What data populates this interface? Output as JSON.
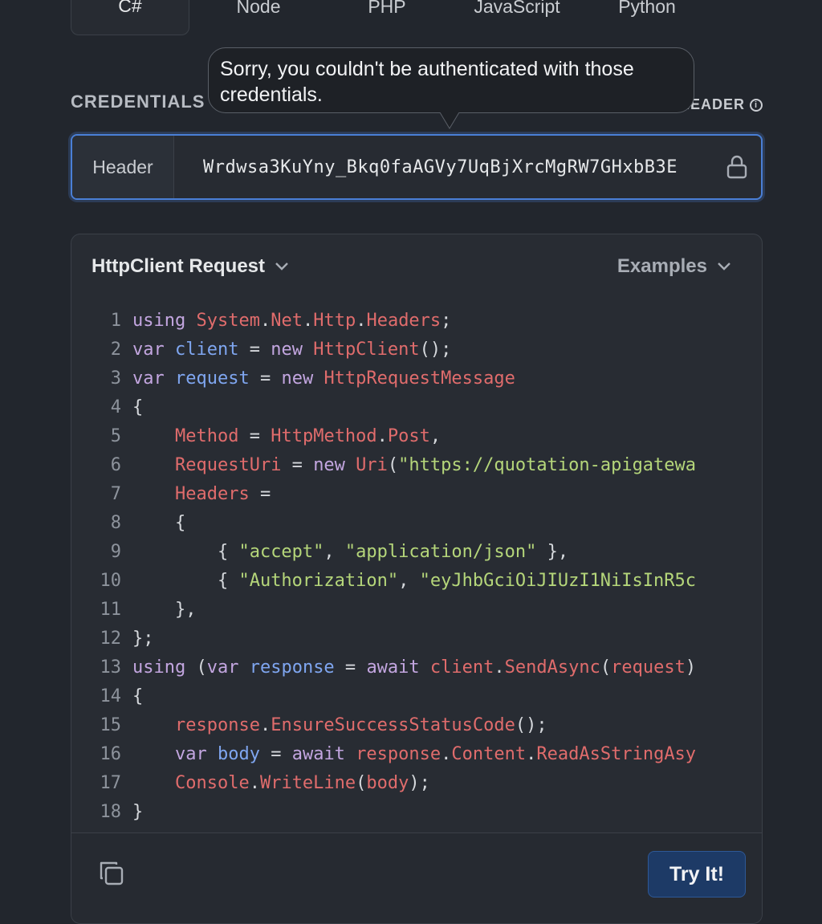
{
  "lang_tabs": [
    {
      "label": "C#",
      "active": true
    },
    {
      "label": "Node",
      "active": false
    },
    {
      "label": "PHP",
      "active": false
    },
    {
      "label": "JavaScript",
      "active": false
    },
    {
      "label": "Python",
      "active": false
    }
  ],
  "credentials": {
    "label": "CREDENTIALS",
    "right_label": "HEADER",
    "auth_type": "Header",
    "token_value": "Wrdwsa3KuYny_Bkq0faAGVy7UqBjXrcMgRW7GHxbB3E"
  },
  "tooltip": {
    "text": "Sorry, you couldn't be authenticated with those credentials."
  },
  "code_card": {
    "request_label": "HttpClient Request",
    "examples_label": "Examples",
    "try_label": "Try It!",
    "lines": [
      {
        "n": "1"
      },
      {
        "n": "2"
      },
      {
        "n": "3"
      },
      {
        "n": "4"
      },
      {
        "n": "5"
      },
      {
        "n": "6"
      },
      {
        "n": "7"
      },
      {
        "n": "8"
      },
      {
        "n": "9"
      },
      {
        "n": "10"
      },
      {
        "n": "11"
      },
      {
        "n": "12"
      },
      {
        "n": "13"
      },
      {
        "n": "14"
      },
      {
        "n": "15"
      },
      {
        "n": "16"
      },
      {
        "n": "17"
      },
      {
        "n": "18"
      }
    ],
    "code_tokens": [
      [
        [
          "kw",
          "using "
        ],
        [
          "ty",
          "System"
        ],
        [
          "pn",
          "."
        ],
        [
          "ty",
          "Net"
        ],
        [
          "pn",
          "."
        ],
        [
          "ty",
          "Http"
        ],
        [
          "pn",
          "."
        ],
        [
          "ty",
          "Headers"
        ],
        [
          "pn",
          ";"
        ]
      ],
      [
        [
          "kw",
          "var "
        ],
        [
          "vr",
          "client"
        ],
        [
          "pn",
          " = "
        ],
        [
          "kw",
          "new "
        ],
        [
          "ty",
          "HttpClient"
        ],
        [
          "pn",
          "();"
        ]
      ],
      [
        [
          "kw",
          "var "
        ],
        [
          "vr",
          "request"
        ],
        [
          "pn",
          " = "
        ],
        [
          "kw",
          "new "
        ],
        [
          "ty",
          "HttpRequestMessage"
        ]
      ],
      [
        [
          "pn",
          "{"
        ]
      ],
      [
        [
          "pn",
          "    "
        ],
        [
          "ty",
          "Method"
        ],
        [
          "pn",
          " = "
        ],
        [
          "ty",
          "HttpMethod"
        ],
        [
          "pn",
          "."
        ],
        [
          "ty",
          "Post"
        ],
        [
          "pn",
          ","
        ]
      ],
      [
        [
          "pn",
          "    "
        ],
        [
          "ty",
          "RequestUri"
        ],
        [
          "pn",
          " = "
        ],
        [
          "kw",
          "new "
        ],
        [
          "ty",
          "Uri"
        ],
        [
          "pn",
          "("
        ],
        [
          "st",
          "\"https://quotation-apigatewa"
        ]
      ],
      [
        [
          "pn",
          "    "
        ],
        [
          "ty",
          "Headers"
        ],
        [
          "pn",
          " ="
        ]
      ],
      [
        [
          "pn",
          "    {"
        ]
      ],
      [
        [
          "pn",
          "        { "
        ],
        [
          "st",
          "\"accept\""
        ],
        [
          "pn",
          ", "
        ],
        [
          "st",
          "\"application/json\""
        ],
        [
          "pn",
          " },"
        ]
      ],
      [
        [
          "pn",
          "        { "
        ],
        [
          "st",
          "\"Authorization\""
        ],
        [
          "pn",
          ", "
        ],
        [
          "st",
          "\"eyJhbGciOiJIUzI1NiIsInR5c"
        ]
      ],
      [
        [
          "pn",
          "    },"
        ]
      ],
      [
        [
          "pn",
          "};"
        ]
      ],
      [
        [
          "kw",
          "using "
        ],
        [
          "pn",
          "("
        ],
        [
          "kw",
          "var "
        ],
        [
          "vr",
          "response"
        ],
        [
          "pn",
          " = "
        ],
        [
          "kw",
          "await "
        ],
        [
          "ty",
          "client"
        ],
        [
          "pn",
          "."
        ],
        [
          "ty",
          "SendAsync"
        ],
        [
          "pn",
          "("
        ],
        [
          "ty",
          "request"
        ],
        [
          "pn",
          ")"
        ]
      ],
      [
        [
          "pn",
          "{"
        ]
      ],
      [
        [
          "pn",
          "    "
        ],
        [
          "ty",
          "response"
        ],
        [
          "pn",
          "."
        ],
        [
          "ty",
          "EnsureSuccessStatusCode"
        ],
        [
          "pn",
          "();"
        ]
      ],
      [
        [
          "pn",
          "    "
        ],
        [
          "kw",
          "var "
        ],
        [
          "vr",
          "body"
        ],
        [
          "pn",
          " = "
        ],
        [
          "kw",
          "await "
        ],
        [
          "ty",
          "response"
        ],
        [
          "pn",
          "."
        ],
        [
          "ty",
          "Content"
        ],
        [
          "pn",
          "."
        ],
        [
          "ty",
          "ReadAsStringAsy"
        ]
      ],
      [
        [
          "pn",
          "    "
        ],
        [
          "ty",
          "Console"
        ],
        [
          "pn",
          "."
        ],
        [
          "ty",
          "WriteLine"
        ],
        [
          "pn",
          "("
        ],
        [
          "ty",
          "body"
        ],
        [
          "pn",
          ");"
        ]
      ],
      [
        [
          "pn",
          "}"
        ]
      ]
    ]
  },
  "colors": {
    "background": "#22262d",
    "accent_focus": "#4a7fd6",
    "try_button": "#1d3a66"
  }
}
